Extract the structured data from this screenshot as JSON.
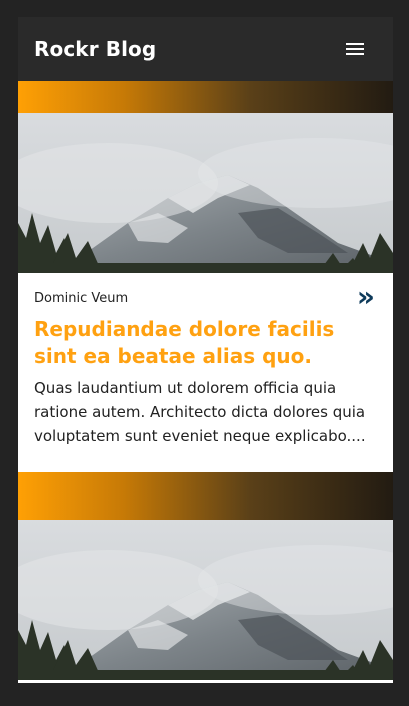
{
  "header": {
    "brand": "Rockr Blog",
    "menu_icon": "hamburger-menu-icon"
  },
  "posts": [
    {
      "author": "Dominic Veum",
      "title": "Repudiandae dolore facilis sint ea beatae alias quo.",
      "excerpt": "Quas laudantium ut dolorem officia quia ratione autem. Architecto dicta dolores quia voluptatem sunt eveniet neque explicabo....",
      "more_icon": "double-chevron-right-icon",
      "more_glyph": "»"
    }
  ],
  "colors": {
    "page_background": "#232323",
    "header_background": "#2a2a2a",
    "accent": "#ffa111",
    "gradient_start": "#ffa005",
    "gradient_end": "#221b12",
    "link_icon": "#0e3a5a"
  }
}
